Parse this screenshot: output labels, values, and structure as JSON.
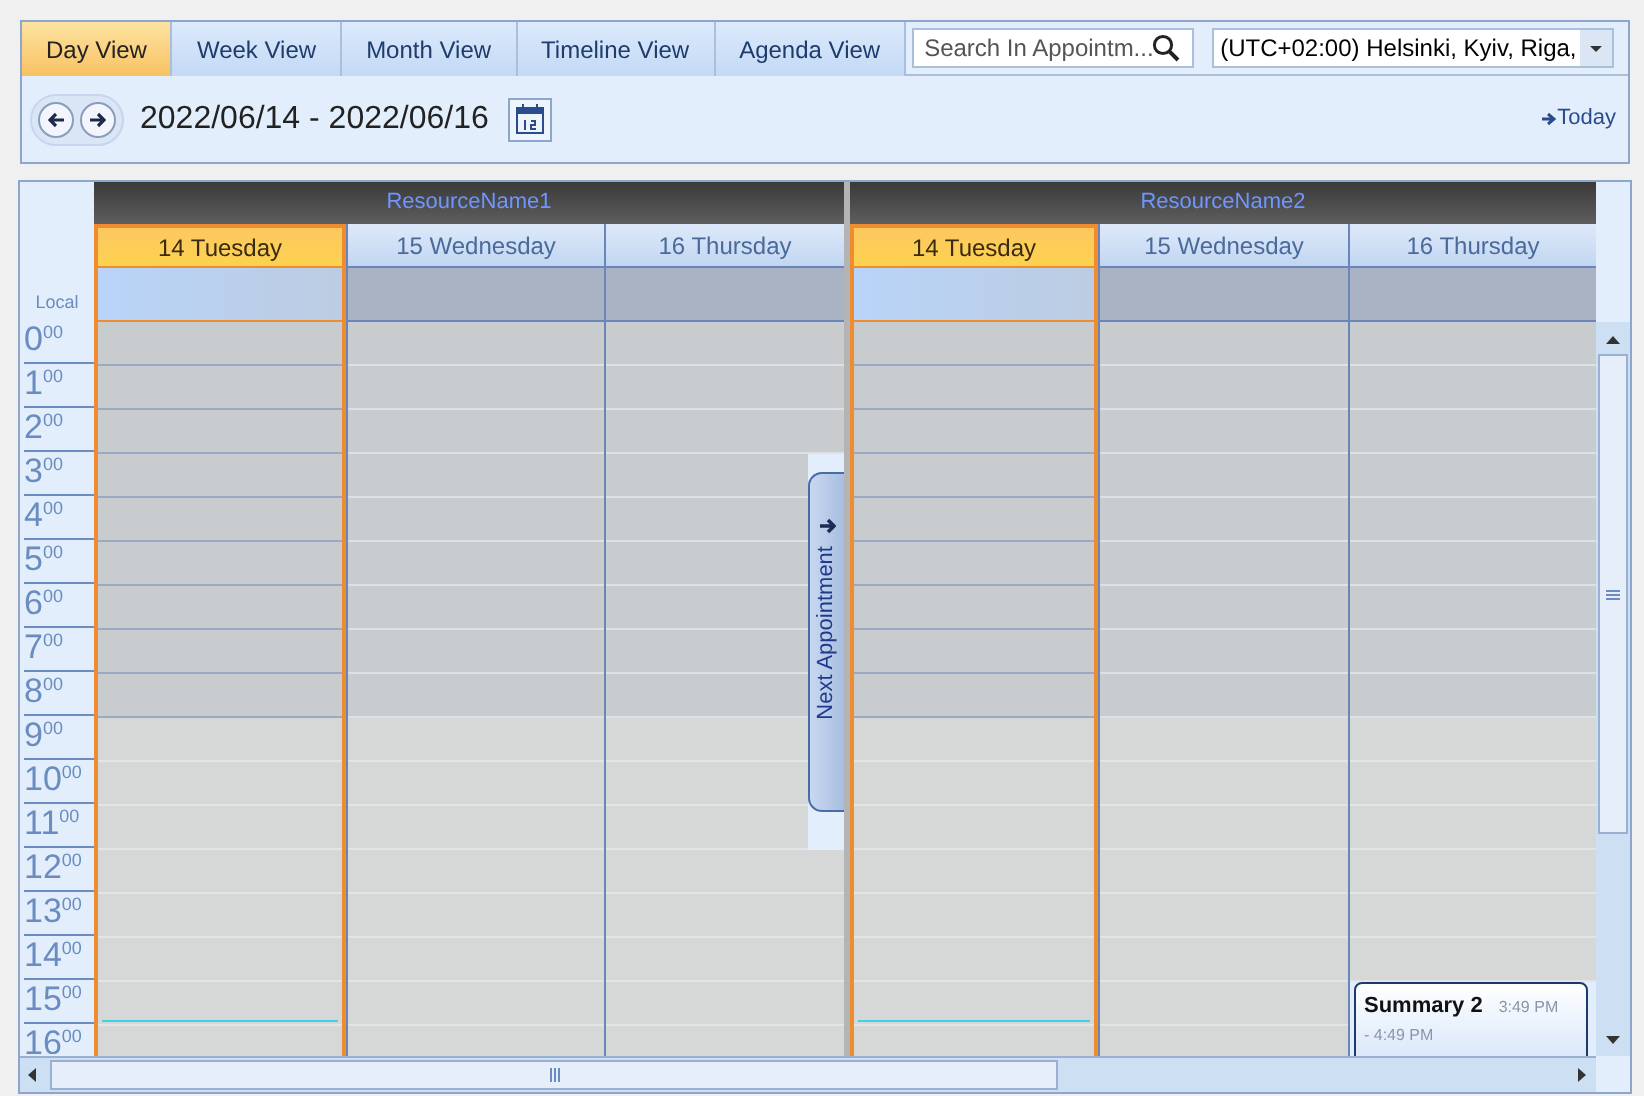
{
  "tabs": [
    {
      "label": "Day View",
      "selected": true
    },
    {
      "label": "Week View",
      "selected": false
    },
    {
      "label": "Month View",
      "selected": false
    },
    {
      "label": "Timeline View",
      "selected": false
    },
    {
      "label": "Agenda View",
      "selected": false
    }
  ],
  "search": {
    "placeholder": "Search In Appointm..."
  },
  "timezone": {
    "value": "(UTC+02:00) Helsinki, Kyiv, Riga,"
  },
  "date_range": "2022/06/14 - 2022/06/16",
  "today_link": "Today",
  "time_zone_label": "Local",
  "resources": [
    {
      "name": "ResourceName1",
      "days": [
        {
          "label": "14 Tuesday",
          "today": true
        },
        {
          "label": "15 Wednesday",
          "today": false
        },
        {
          "label": "16 Thursday",
          "today": false
        }
      ]
    },
    {
      "name": "ResourceName2",
      "days": [
        {
          "label": "14 Tuesday",
          "today": true
        },
        {
          "label": "15 Wednesday",
          "today": false
        },
        {
          "label": "16 Thursday",
          "today": false,
          "appointments": [
            {
              "title": "Summary 2",
              "start": "3:49 PM",
              "end": "- 4:49 PM"
            }
          ]
        }
      ]
    }
  ],
  "hours": [
    {
      "hour": "0",
      "minutes": "00",
      "working": false
    },
    {
      "hour": "1",
      "minutes": "00",
      "working": false
    },
    {
      "hour": "2",
      "minutes": "00",
      "working": false
    },
    {
      "hour": "3",
      "minutes": "00",
      "working": false
    },
    {
      "hour": "4",
      "minutes": "00",
      "working": false
    },
    {
      "hour": "5",
      "minutes": "00",
      "working": false
    },
    {
      "hour": "6",
      "minutes": "00",
      "working": false
    },
    {
      "hour": "7",
      "minutes": "00",
      "working": false
    },
    {
      "hour": "8",
      "minutes": "00",
      "working": false
    },
    {
      "hour": "9",
      "minutes": "00",
      "working": true
    },
    {
      "hour": "10",
      "minutes": "00",
      "working": true
    },
    {
      "hour": "11",
      "minutes": "00",
      "working": true
    },
    {
      "hour": "12",
      "minutes": "00",
      "working": true
    },
    {
      "hour": "13",
      "minutes": "00",
      "working": true
    },
    {
      "hour": "14",
      "minutes": "00",
      "working": true
    },
    {
      "hour": "15",
      "minutes": "00",
      "working": true
    },
    {
      "hour": "16",
      "minutes": "00",
      "working": true
    }
  ],
  "next_appointment": "Next Appointment"
}
